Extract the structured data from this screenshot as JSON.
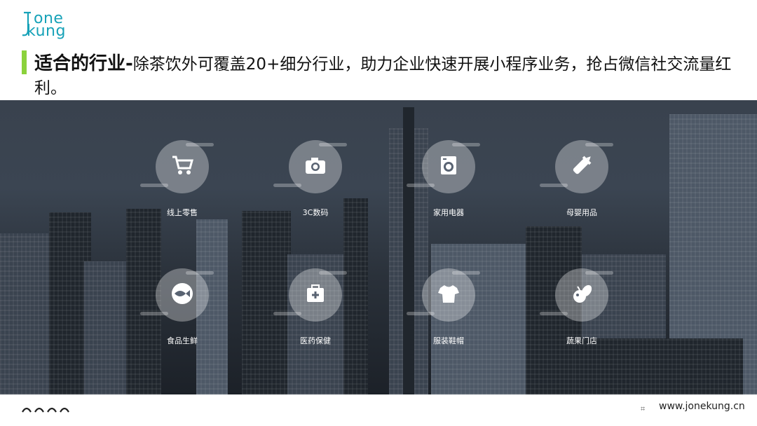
{
  "header": {
    "logo_line1": "one",
    "logo_line2": "kung",
    "title_strong": "适合的行业-",
    "title_rest": "除茶饮外可覆盖20+细分行业，助力企业快速开展小程序业务，抢占微信社交流量红利。"
  },
  "industries": [
    {
      "label": "线上零售",
      "icon": "shopping-cart-icon"
    },
    {
      "label": "3C数码",
      "icon": "camera-icon"
    },
    {
      "label": "家用电器",
      "icon": "washing-machine-icon"
    },
    {
      "label": "母婴用品",
      "icon": "baby-bottle-icon"
    },
    {
      "label": "食品生鲜",
      "icon": "fish-icon"
    },
    {
      "label": "医药保健",
      "icon": "medical-kit-icon"
    },
    {
      "label": "服装鞋帽",
      "icon": "tshirt-icon"
    },
    {
      "label": "蔬果门店",
      "icon": "vegetable-icon"
    }
  ],
  "footer": {
    "hash": "⌗",
    "url": "www.jonekung.cn"
  },
  "colors": {
    "accent_bar": "#8bd23c",
    "logo": "#17a2b8"
  }
}
